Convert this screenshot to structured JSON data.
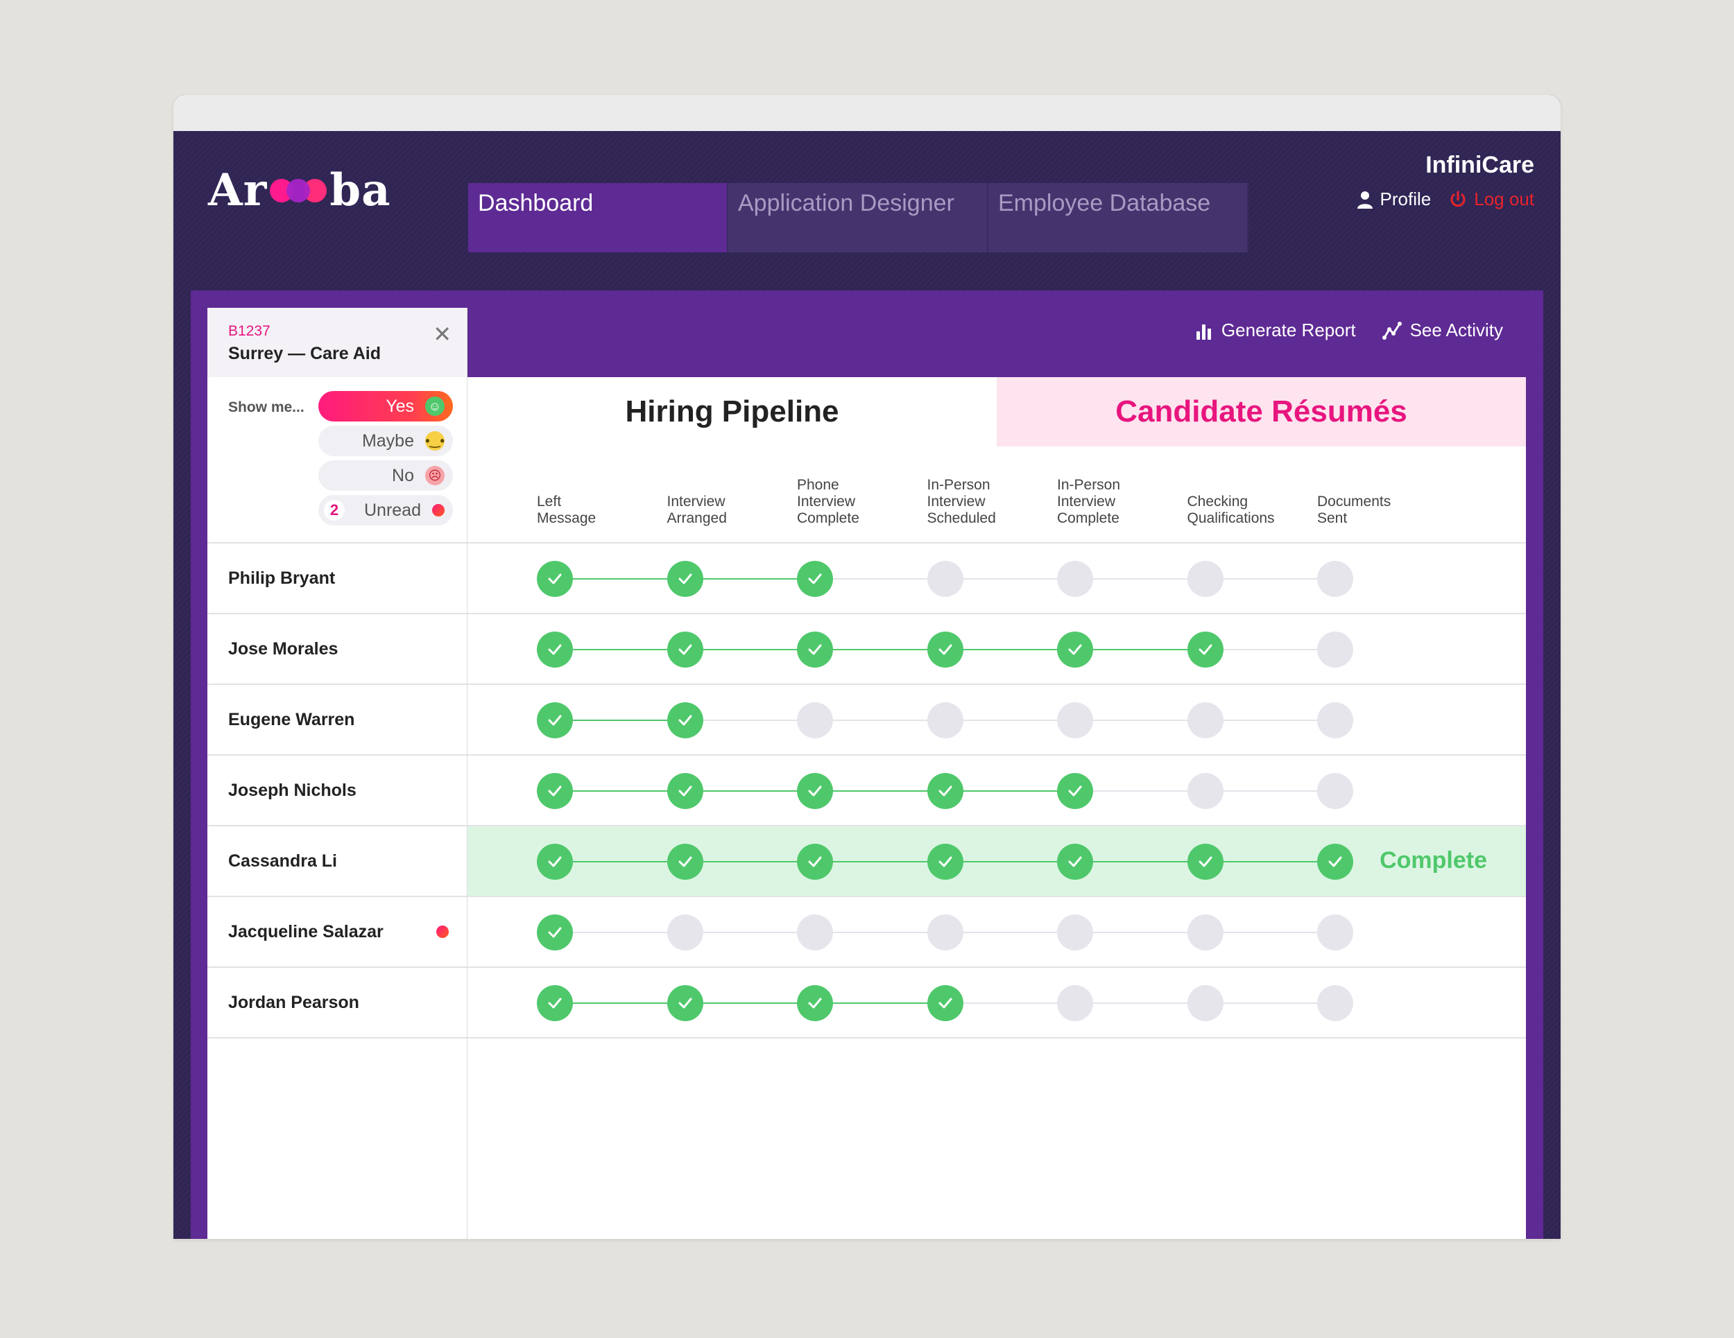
{
  "brand": {
    "logo_left": "Ar",
    "logo_right": "ba"
  },
  "nav": {
    "tabs": [
      {
        "label": "Dashboard",
        "active": true
      },
      {
        "label": "Application Designer",
        "active": false
      },
      {
        "label": "Employee Database",
        "active": false
      }
    ]
  },
  "account": {
    "company": "InfiniCare",
    "profile_label": "Profile",
    "logout_label": "Log out"
  },
  "actions": {
    "generate_report": "Generate Report",
    "see_activity": "See Activity"
  },
  "job": {
    "id": "B1237",
    "title": "Surrey — Care Aid"
  },
  "filters": {
    "label": "Show me...",
    "options": [
      {
        "label": "Yes",
        "active": true,
        "icon": "smile-icon"
      },
      {
        "label": "Maybe",
        "active": false,
        "icon": "neutral-face-icon"
      },
      {
        "label": "No",
        "active": false,
        "icon": "sad-face-icon"
      },
      {
        "label": "Unread",
        "count": "2",
        "active": false,
        "icon": "red-dot-icon"
      }
    ]
  },
  "main_tabs": {
    "pipeline": "Hiring Pipeline",
    "resumes": "Candidate Résumés"
  },
  "stages": [
    "Left\nMessage",
    "Interview\nArranged",
    "Phone\nInterview\nComplete",
    "In-Person\nInterview\nScheduled",
    "In-Person\nInterview\nComplete",
    "Checking\nQualifications",
    "Documents\nSent"
  ],
  "candidates": [
    {
      "name": "Philip Bryant",
      "completed": 3,
      "unread": false
    },
    {
      "name": "Jose Morales",
      "completed": 6,
      "unread": false
    },
    {
      "name": "Eugene Warren",
      "completed": 2,
      "unread": false
    },
    {
      "name": "Joseph Nichols",
      "completed": 5,
      "unread": false
    },
    {
      "name": "Cassandra Li",
      "completed": 7,
      "unread": false
    },
    {
      "name": "Jacqueline Salazar",
      "completed": 1,
      "unread": true
    },
    {
      "name": "Jordan Pearson",
      "completed": 4,
      "unread": false
    }
  ],
  "complete_label": "Complete",
  "colors": {
    "accent_pink": "#e8157e",
    "purple": "#5e2a93",
    "green": "#4fc86b",
    "logout_red": "#e8232a"
  }
}
